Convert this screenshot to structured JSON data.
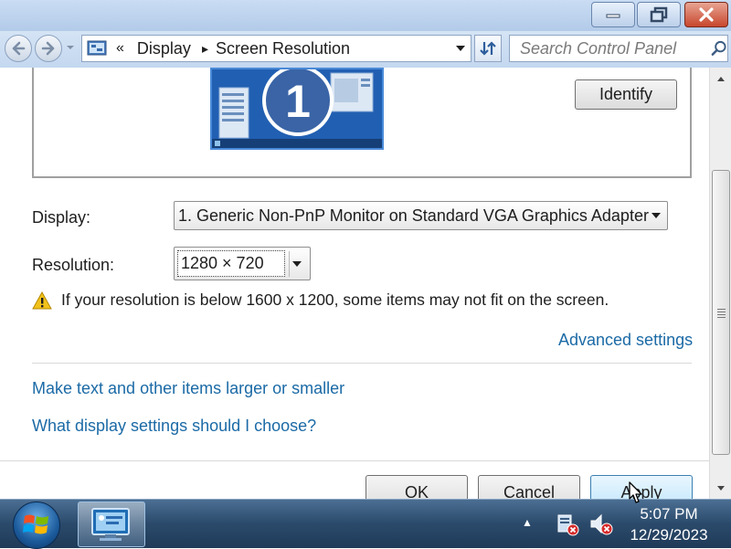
{
  "window": {
    "controls": {
      "minimize": "minimize",
      "maximize": "maximize",
      "close": "close"
    }
  },
  "address": {
    "overflow_glyph": "«",
    "breadcrumb": [
      "Display",
      "Screen Resolution"
    ],
    "separator_glyph": "▸"
  },
  "search": {
    "placeholder": "Search Control Panel"
  },
  "preview": {
    "monitor_number": "1",
    "identify_label": "Identify"
  },
  "form": {
    "display_label": "Display:",
    "display_value": "1. Generic Non-PnP Monitor on Standard VGA Graphics Adapter",
    "resolution_label": "Resolution:",
    "resolution_value": "1280 × 720",
    "warning": "If your resolution is below 1600 x 1200, some items may not fit on the screen.",
    "advanced_link": "Advanced settings"
  },
  "links": {
    "text_size": "Make text and other items larger or smaller",
    "help": "What display settings should I choose?"
  },
  "buttons": {
    "ok": "OK",
    "cancel": "Cancel",
    "apply": "Apply"
  },
  "taskbar": {
    "time": "5:07 PM",
    "date": "12/29/2023",
    "tray_expand_glyph": "▲"
  },
  "colors": {
    "link": "#1b6aa6",
    "titlebar": "#c9dcf3",
    "taskbar": "#2b4a6b",
    "monitor_preview": "#215fb2",
    "warning": "#f2c21b"
  },
  "icons": [
    "minimize-icon",
    "maximize-icon",
    "close-icon",
    "back-arrow-icon",
    "forward-arrow-icon",
    "control-panel-icon",
    "chevron-down-icon",
    "refresh-icon",
    "search-icon",
    "warning-icon",
    "windows-logo-icon",
    "display-settings-icon",
    "network-icon",
    "volume-icon",
    "mouse-cursor-icon"
  ]
}
